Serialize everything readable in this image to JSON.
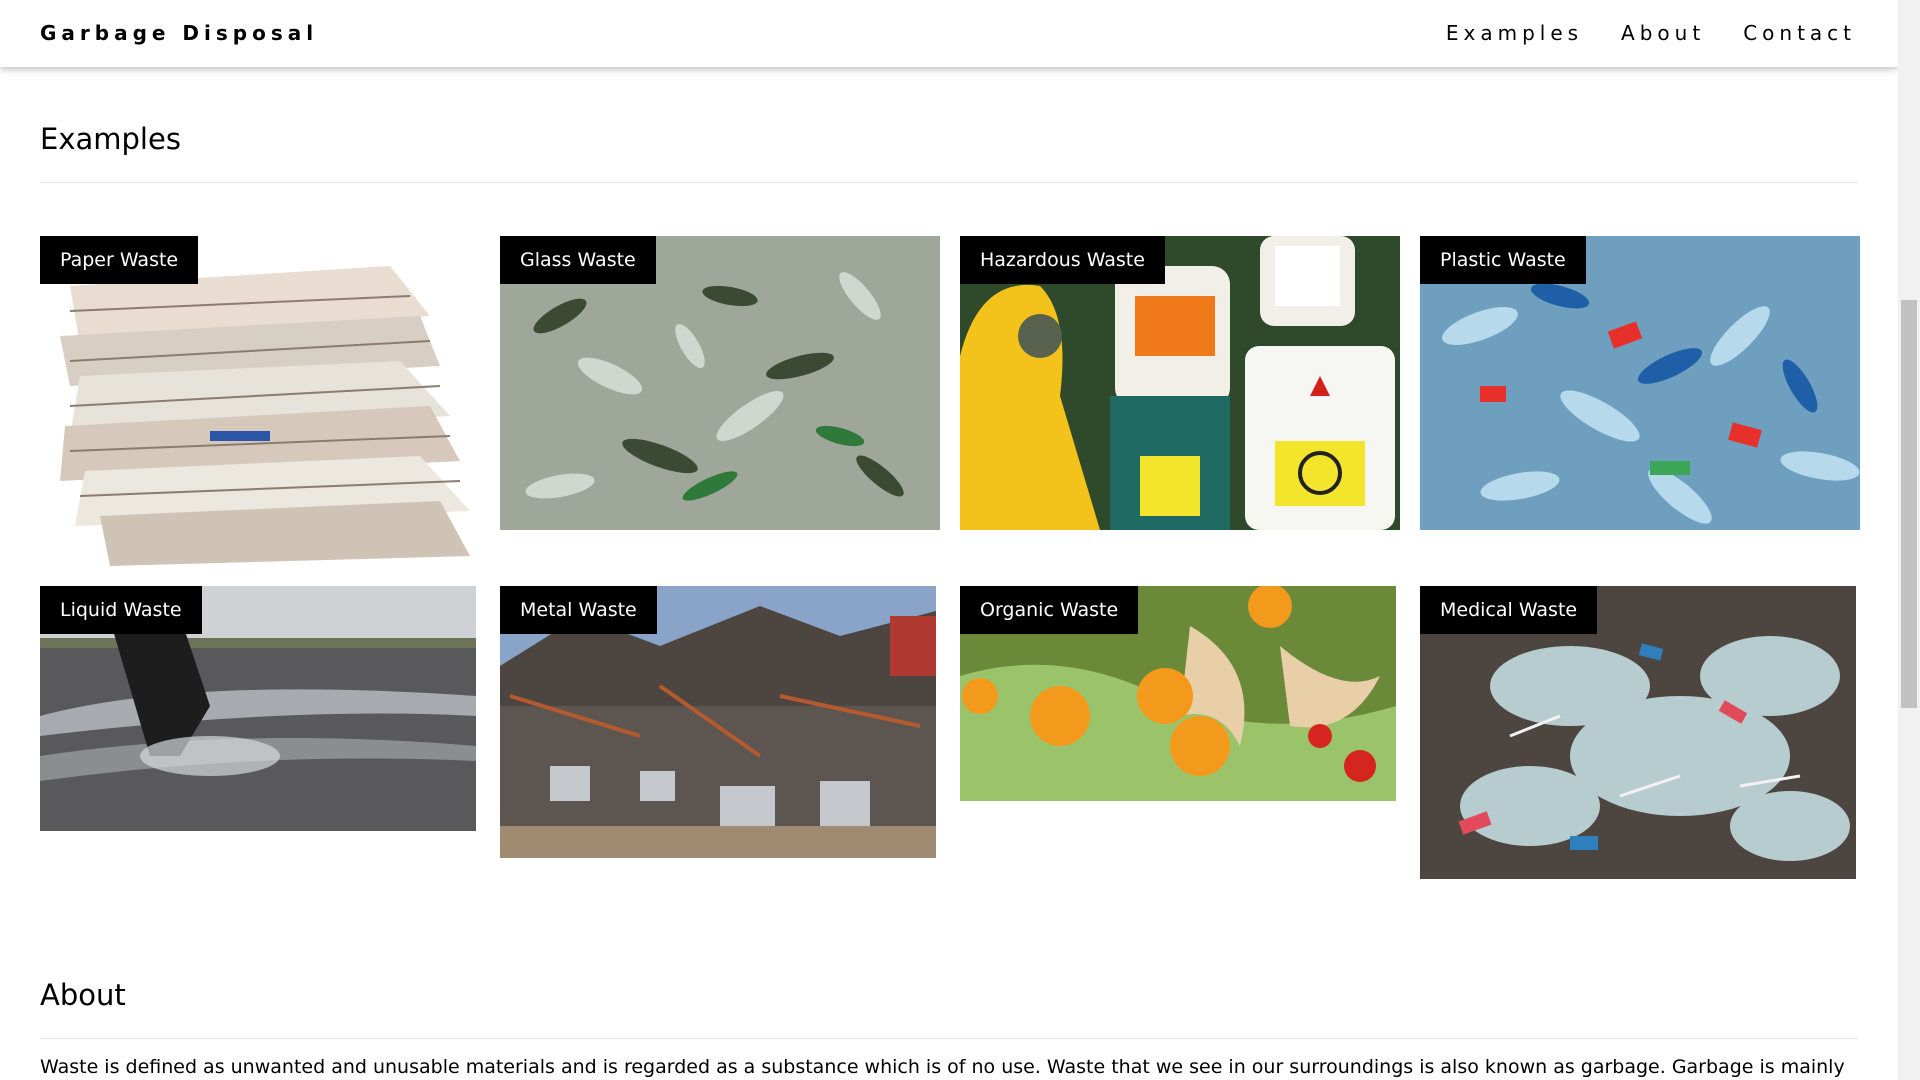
{
  "navbar": {
    "brand": "Garbage Disposal",
    "links": [
      "Examples",
      "About",
      "Contact"
    ]
  },
  "examples": {
    "title": "Examples",
    "cards": [
      {
        "label": "Paper Waste",
        "image": "stack-of-newspapers"
      },
      {
        "label": "Glass Waste",
        "image": "pile-of-glass-bottles"
      },
      {
        "label": "Hazardous Waste",
        "image": "radioactive-barrels-hazmat-suit"
      },
      {
        "label": "Plastic Waste",
        "image": "pile-of-plastic-bottles"
      },
      {
        "label": "Liquid Waste",
        "image": "sewage-pipe-discharge"
      },
      {
        "label": "Metal Waste",
        "image": "scrap-metal-pile"
      },
      {
        "label": "Organic Waste",
        "image": "food-scraps-oranges-vegetables"
      },
      {
        "label": "Medical Waste",
        "image": "syringes-and-plastic-on-pavement"
      }
    ]
  },
  "about": {
    "title": "About",
    "text": "Waste is defined as unwanted and unusable materials and is regarded as a substance which is of no use. Waste that we see in our surroundings is also known as garbage. Garbage is mainly"
  },
  "colors": {
    "label_bg": "#000000",
    "label_text": "#ffffff",
    "page_bg": "#ffffff"
  }
}
